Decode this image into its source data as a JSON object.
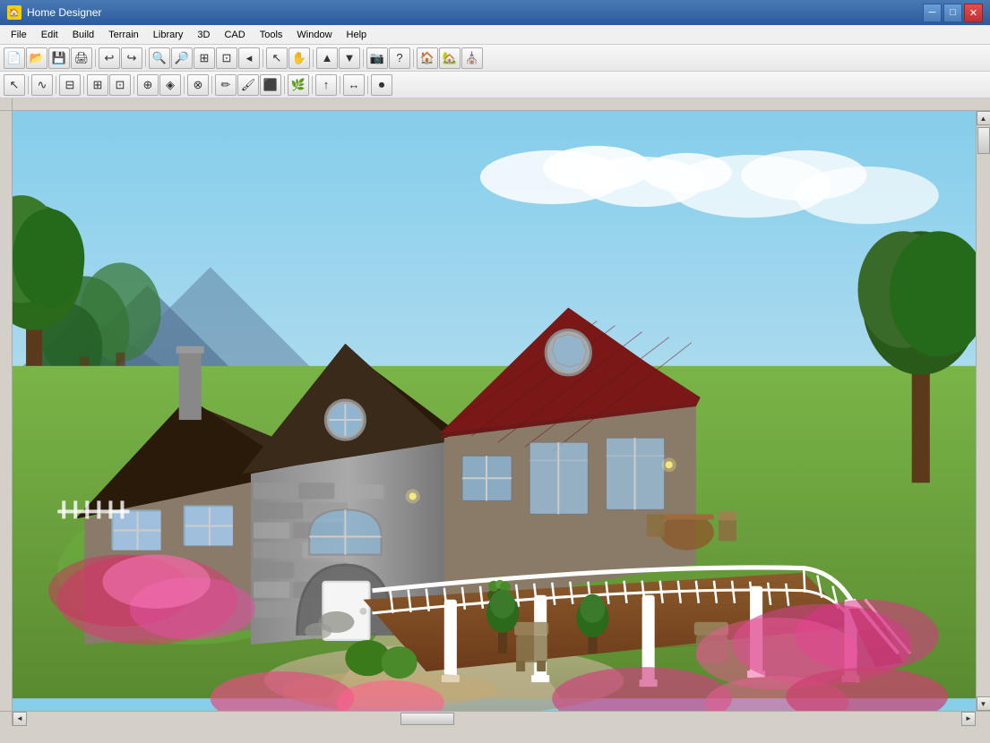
{
  "window": {
    "title": "Home Designer",
    "icon": "🏠"
  },
  "titleButtons": {
    "minimize": "─",
    "maximize": "□",
    "close": "✕"
  },
  "menu": {
    "items": [
      {
        "id": "file",
        "label": "File"
      },
      {
        "id": "edit",
        "label": "Edit"
      },
      {
        "id": "build",
        "label": "Build"
      },
      {
        "id": "terrain",
        "label": "Terrain"
      },
      {
        "id": "library",
        "label": "Library"
      },
      {
        "id": "3d",
        "label": "3D"
      },
      {
        "id": "cad",
        "label": "CAD"
      },
      {
        "id": "tools",
        "label": "Tools"
      },
      {
        "id": "window",
        "label": "Window"
      },
      {
        "id": "help",
        "label": "Help"
      }
    ]
  },
  "toolbar1": {
    "buttons": [
      {
        "id": "new",
        "icon": "📄",
        "label": "New"
      },
      {
        "id": "open",
        "icon": "📂",
        "label": "Open"
      },
      {
        "id": "save",
        "icon": "💾",
        "label": "Save"
      },
      {
        "id": "print",
        "icon": "🖨",
        "label": "Print"
      },
      {
        "id": "sep1",
        "sep": true
      },
      {
        "id": "undo",
        "icon": "↩",
        "label": "Undo"
      },
      {
        "id": "redo",
        "icon": "↪",
        "label": "Redo"
      },
      {
        "id": "sep2",
        "sep": true
      },
      {
        "id": "zoom-out",
        "icon": "🔍",
        "label": "Zoom Out"
      },
      {
        "id": "zoom-in",
        "icon": "🔎",
        "label": "Zoom In"
      },
      {
        "id": "zoom-window",
        "icon": "⊞",
        "label": "Zoom Window"
      },
      {
        "id": "zoom-fit",
        "icon": "⊡",
        "label": "Zoom Fit"
      },
      {
        "id": "zoom-prev",
        "icon": "◂",
        "label": "Zoom Previous"
      },
      {
        "id": "sep3",
        "sep": true
      },
      {
        "id": "select",
        "icon": "↖",
        "label": "Select"
      },
      {
        "id": "pan",
        "icon": "✋",
        "label": "Pan"
      },
      {
        "id": "sep4",
        "sep": true
      },
      {
        "id": "floor-up",
        "icon": "▲",
        "label": "Floor Up"
      },
      {
        "id": "floor-down",
        "icon": "▼",
        "label": "Floor Down"
      },
      {
        "id": "sep5",
        "sep": true
      },
      {
        "id": "camera",
        "icon": "📷",
        "label": "Camera"
      },
      {
        "id": "help-btn",
        "icon": "?",
        "label": "Help"
      },
      {
        "id": "sep6",
        "sep": true
      },
      {
        "id": "house1",
        "icon": "🏠",
        "label": "House 1"
      },
      {
        "id": "house2",
        "icon": "🏡",
        "label": "House 2"
      },
      {
        "id": "house3",
        "icon": "⛪",
        "label": "House 3"
      }
    ]
  },
  "toolbar2": {
    "buttons": [
      {
        "id": "select2",
        "icon": "↖",
        "label": "Select"
      },
      {
        "id": "sep1",
        "sep": true
      },
      {
        "id": "draw1",
        "icon": "∿",
        "label": "Draw 1"
      },
      {
        "id": "sep2",
        "sep": true
      },
      {
        "id": "wall",
        "icon": "⊟",
        "label": "Wall"
      },
      {
        "id": "sep3",
        "sep": true
      },
      {
        "id": "stair",
        "icon": "⊞",
        "label": "Stairs"
      },
      {
        "id": "room",
        "icon": "⊡",
        "label": "Room"
      },
      {
        "id": "sep4",
        "sep": true
      },
      {
        "id": "symbol",
        "icon": "⊕",
        "label": "Symbol"
      },
      {
        "id": "layer",
        "icon": "◈",
        "label": "Layer"
      },
      {
        "id": "sep5",
        "sep": true
      },
      {
        "id": "copy",
        "icon": "⊗",
        "label": "Copy"
      },
      {
        "id": "sep6",
        "sep": true
      },
      {
        "id": "pencil",
        "icon": "✏",
        "label": "Pencil"
      },
      {
        "id": "brush",
        "icon": "🖌",
        "label": "Brush"
      },
      {
        "id": "fill",
        "icon": "⬛",
        "label": "Fill"
      },
      {
        "id": "sep7",
        "sep": true
      },
      {
        "id": "plants",
        "icon": "🌿",
        "label": "Plants"
      },
      {
        "id": "sep8",
        "sep": true
      },
      {
        "id": "arrow",
        "icon": "↑",
        "label": "Arrow"
      },
      {
        "id": "sep9",
        "sep": true
      },
      {
        "id": "dimension",
        "icon": "↔",
        "label": "Dimension"
      },
      {
        "id": "sep10",
        "sep": true
      },
      {
        "id": "record",
        "icon": "⏺",
        "label": "Record"
      }
    ]
  },
  "statusBar": {
    "text": ""
  },
  "scene": {
    "description": "3D rendered house with red roof, stone facade, wrap-around deck, garden"
  }
}
